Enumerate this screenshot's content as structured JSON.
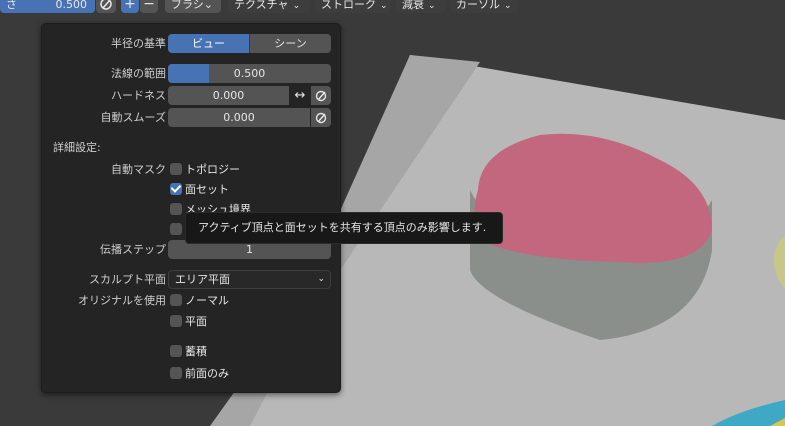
{
  "colors": {
    "accent": "#4772b3",
    "field": "#545454",
    "panel_bg": "#242424",
    "viewport_bg": "#3a3a3a",
    "mesh_top": "#c2677e",
    "mesh_side": "#8a8f8c",
    "ground": "#b8b8b8"
  },
  "header": {
    "strength_label": "さ",
    "strength_value": "0.500",
    "add_symbol": "+",
    "sub_symbol": "−",
    "menus": [
      "ブラシ",
      "テクスチャ",
      "ストローク",
      "減衰",
      "カーソル"
    ]
  },
  "panel": {
    "radius_base": {
      "label": "半径の基準",
      "options": [
        "ビュー",
        "シーン"
      ],
      "selected": "ビュー"
    },
    "normal_radius": {
      "label": "法線の範囲",
      "value": "0.500",
      "fraction": 0.25
    },
    "hardness": {
      "label": "ハードネス",
      "value": "0.000"
    },
    "auto_smooth": {
      "label": "自動スムーズ",
      "value": "0.000"
    },
    "details_label": "詳細設定:",
    "auto_mask": {
      "label": "自動マスク",
      "items": [
        {
          "label": "トポロジー",
          "checked": false
        },
        {
          "label": "面セット",
          "checked": true
        },
        {
          "label": "メッシュ境界",
          "checked": false
        },
        {
          "label": "",
          "checked": false
        }
      ]
    },
    "propagation_steps": {
      "label": "伝播ステップ",
      "value": "1"
    },
    "sculpt_plane": {
      "label": "スカルプト平面",
      "value": "エリア平面"
    },
    "use_original": {
      "label": "オリジナルを使用",
      "items": [
        {
          "label": "ノーマル",
          "checked": false
        },
        {
          "label": "平面",
          "checked": false
        }
      ]
    },
    "accumulate": {
      "label": "蓄積",
      "checked": false
    },
    "front_faces_only": {
      "label": "前面のみ",
      "checked": false
    }
  },
  "tooltip": {
    "text": "アクティブ頂点と面セットを共有する頂点のみ影響します."
  }
}
